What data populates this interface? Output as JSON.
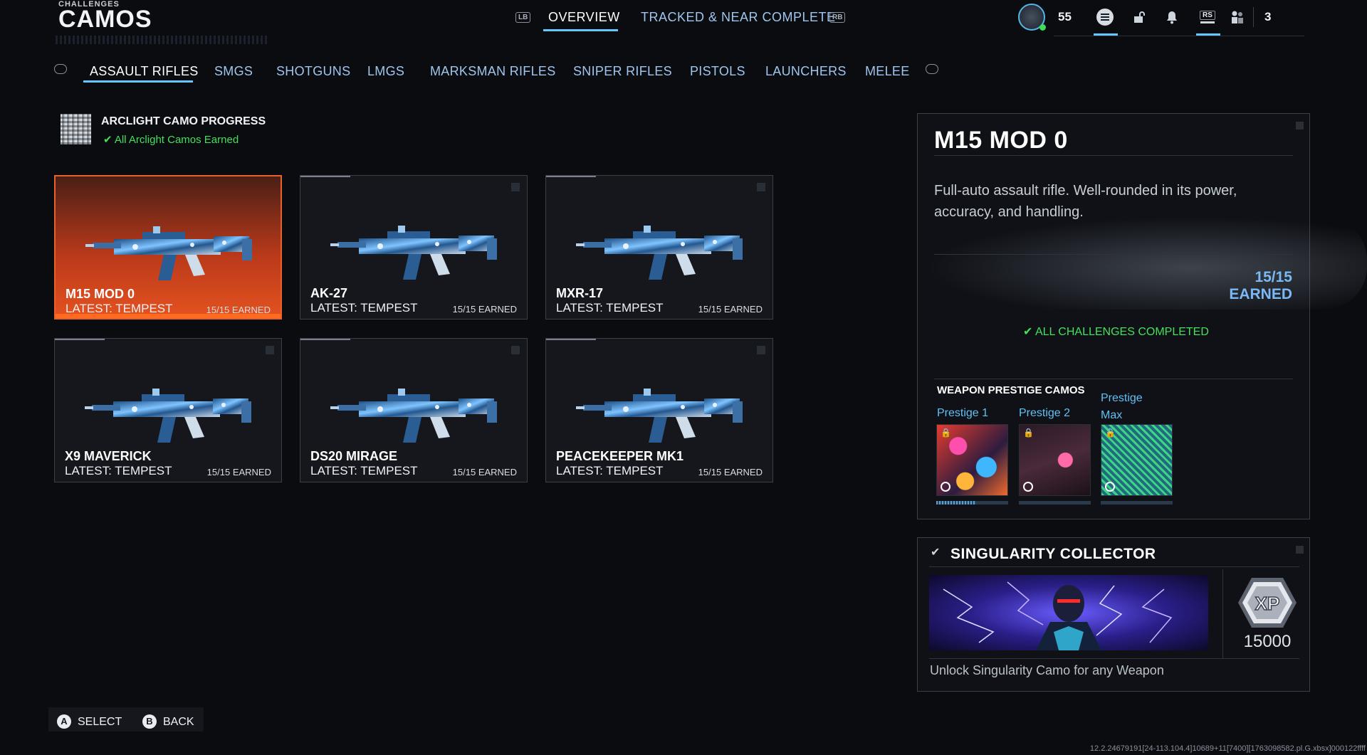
{
  "header": {
    "section": "CHALLENGES",
    "title": "CAMOS"
  },
  "top_nav": {
    "left_bumper": "LB",
    "right_bumper": "RB",
    "tabs": [
      {
        "label": "OVERVIEW",
        "active": true
      },
      {
        "label": "TRACKED & NEAR COMPLETE",
        "active": false
      }
    ]
  },
  "hud": {
    "level": "55",
    "rs_label": "RS",
    "party_count": "3",
    "icons": [
      "menu-icon",
      "unlock-icon",
      "bell-icon",
      "rs-icon",
      "party-icon"
    ]
  },
  "categories": [
    {
      "label": "ASSAULT RIFLES",
      "active": true
    },
    {
      "label": "SMGS",
      "active": false
    },
    {
      "label": "SHOTGUNS",
      "active": false
    },
    {
      "label": "LMGS",
      "active": false
    },
    {
      "label": "MARKSMAN RIFLES",
      "active": false
    },
    {
      "label": "SNIPER RIFLES",
      "active": false
    },
    {
      "label": "PISTOLS",
      "active": false
    },
    {
      "label": "LAUNCHERS",
      "active": false
    },
    {
      "label": "MELEE",
      "active": false
    }
  ],
  "arclight": {
    "title": "ARCLIGHT CAMO PROGRESS",
    "status": "All Arclight Camos Earned"
  },
  "weapons": [
    {
      "name": "M15 MOD 0",
      "latest": "LATEST: TEMPEST",
      "earned": "15/15 EARNED",
      "selected": true
    },
    {
      "name": "AK-27",
      "latest": "LATEST: TEMPEST",
      "earned": "15/15 EARNED",
      "selected": false
    },
    {
      "name": "MXR-17",
      "latest": "LATEST: TEMPEST",
      "earned": "15/15 EARNED",
      "selected": false
    },
    {
      "name": "X9 MAVERICK",
      "latest": "LATEST: TEMPEST",
      "earned": "15/15 EARNED",
      "selected": false
    },
    {
      "name": "DS20 MIRAGE",
      "latest": "LATEST: TEMPEST",
      "earned": "15/15 EARNED",
      "selected": false
    },
    {
      "name": "PEACEKEEPER MK1",
      "latest": "LATEST: TEMPEST",
      "earned": "15/15 EARNED",
      "selected": false
    }
  ],
  "details": {
    "title": "M15 MOD 0",
    "description": "Full-auto assault rifle. Well-rounded in its power, accuracy, and handling.",
    "earned": "15/15 EARNED",
    "challenges_status": "ALL CHALLENGES COMPLETED",
    "prestige_heading": "WEAPON PRESTIGE CAMOS",
    "prestige": [
      {
        "label": "Prestige 1",
        "locked": true,
        "progress": 0.55
      },
      {
        "label": "Prestige 2",
        "locked": true,
        "progress": 0
      },
      {
        "label": "Prestige Max",
        "locked": true,
        "progress": 0
      }
    ]
  },
  "reward": {
    "title": "SINGULARITY COLLECTOR",
    "xp_label": "XP",
    "xp_value": "15000",
    "description": "Unlock Singularity Camo for any Weapon"
  },
  "footer": {
    "buttons": [
      {
        "key": "A",
        "label": "SELECT"
      },
      {
        "key": "B",
        "label": "BACK"
      }
    ],
    "version": "12.2.24679191[24-113.104.4]10689+11[7400][1763098582.pl.G.xbsx]000122ffff"
  },
  "colors": {
    "accent": "#65c7ff",
    "selected_card": "#e5521f",
    "success": "#45e05b",
    "earned_text": "#7ab9f5"
  }
}
